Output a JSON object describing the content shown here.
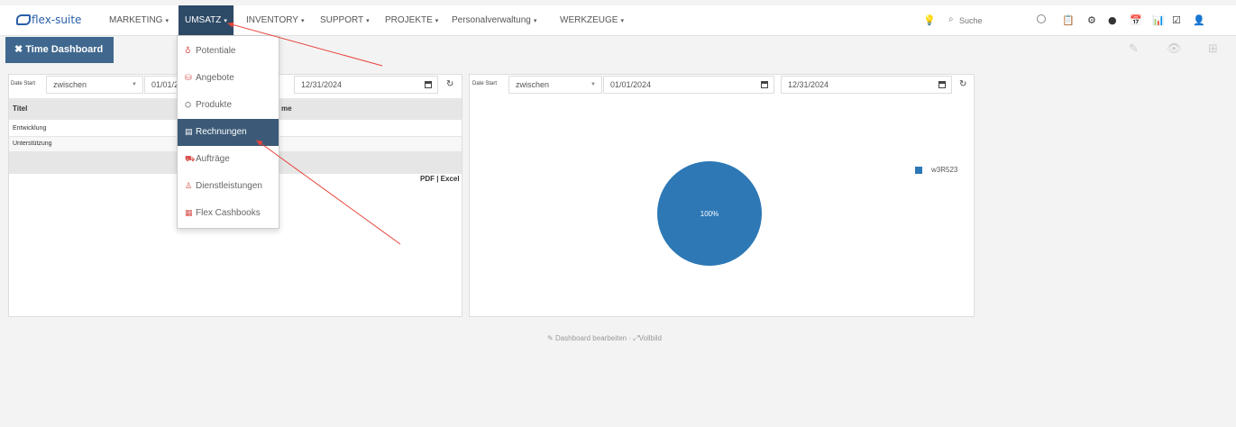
{
  "brand": {
    "logo_text": "flex-suite"
  },
  "nav": {
    "items": [
      {
        "label": "MARKETING",
        "caret": "▾"
      },
      {
        "label": "UMSATZ",
        "caret": "▾"
      },
      {
        "label": "INVENTORY",
        "caret": "▾"
      },
      {
        "label": "SUPPORT",
        "caret": "▾"
      },
      {
        "label": "PROJEKTE",
        "caret": "▾"
      },
      {
        "label": "Personalverwaltung",
        "caret": "▾"
      },
      {
        "label": "WERKZEUGE",
        "caret": "▾"
      }
    ],
    "active": "UMSATZ"
  },
  "search": {
    "placeholder": "Suche"
  },
  "toolbar_icons": [
    "lightbulb-icon",
    "search-icon",
    "clear-icon",
    "clipboard-icon",
    "gear-icon",
    "help-icon",
    "calendar-icon",
    "chart-icon",
    "checkbox-icon",
    "user-icon"
  ],
  "dashboard_button": {
    "icon": "✖",
    "label": "Time Dashboard"
  },
  "right_tools": {
    "edit": "✎",
    "view": "👁",
    "add": "⊞"
  },
  "left_panel": {
    "filter_label": "Date Start",
    "operator": "zwischen",
    "date_from": "01/01/2",
    "date_to": "12/31/2024",
    "columns": [
      "Titel",
      "me"
    ],
    "rows": [
      "Entwicklung",
      "Unterstützung"
    ],
    "export_links": "PDF | Excel"
  },
  "right_panel": {
    "filter_label": "Date Start",
    "operator": "zwischen",
    "date_from": "01/01/2024",
    "date_to": "12/31/2024"
  },
  "chart_data": {
    "type": "pie",
    "categories": [
      "w3R523"
    ],
    "values": [
      100
    ],
    "labels": [
      "100%"
    ],
    "colors": [
      "#2d78b5"
    ],
    "legend": "right"
  },
  "dropdown": {
    "items": [
      {
        "icon": "♁",
        "label": "Potentiale"
      },
      {
        "icon": "⛁",
        "label": "Angebote"
      },
      {
        "icon": "⛭",
        "label": "Produkte"
      },
      {
        "icon": "▤",
        "label": "Rechnungen"
      },
      {
        "icon": "⛟",
        "label": "Aufträge"
      },
      {
        "icon": "♙",
        "label": "Dienstleistungen"
      },
      {
        "icon": "▦",
        "label": "Flex Cashbooks"
      }
    ],
    "active": "Rechnungen"
  },
  "footer": {
    "edit_label": "Dashboard bearbeiten",
    "separator": "·",
    "fullscreen_label": "Vollbild"
  },
  "colors": {
    "nav_active": "#2d4a66",
    "button": "#40688e",
    "pie": "#2d78b5",
    "arrow": "#e8433a"
  }
}
